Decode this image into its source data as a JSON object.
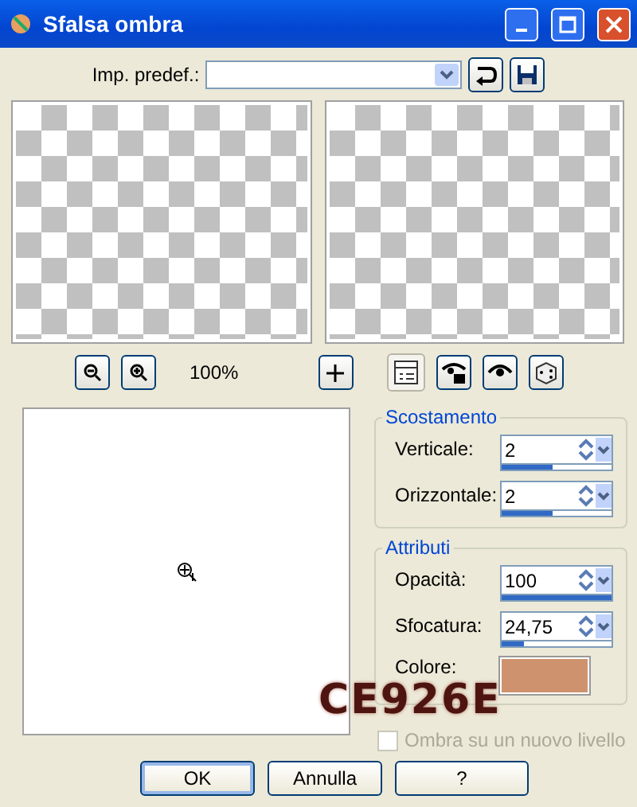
{
  "window": {
    "title": "Sfalsa ombra"
  },
  "preset": {
    "label": "Imp. predef.:"
  },
  "zoom": {
    "reading": "100%"
  },
  "view_buttons": [
    {
      "kind": "properties",
      "selected": true
    },
    {
      "kind": "eye-lock",
      "selected": false
    },
    {
      "kind": "eye",
      "selected": false
    },
    {
      "kind": "dice",
      "selected": false
    }
  ],
  "offset": {
    "title": "Scostamento",
    "fields": [
      {
        "label": "Verticale:",
        "value": "2",
        "level": 0.47
      },
      {
        "label": "Orizzontale:",
        "value": "2",
        "level": 0.47
      }
    ]
  },
  "attributes": {
    "title": "Attributi",
    "fields": [
      {
        "label": "Opacità:",
        "value": "100",
        "level": 1
      },
      {
        "label": "Sfocatura:",
        "value": "24,75",
        "level": 0.2
      }
    ],
    "color": {
      "label": "Colore:",
      "color": "#ce926e"
    },
    "new_layer": {
      "label": "Ombra su un nuovo livello",
      "checked": false,
      "disabled": true
    }
  },
  "annotation": "CE926E",
  "buttons": [
    {
      "label": "OK",
      "default": true
    },
    {
      "label": "Annulla",
      "default": false
    },
    {
      "label": "?",
      "default": false
    }
  ]
}
